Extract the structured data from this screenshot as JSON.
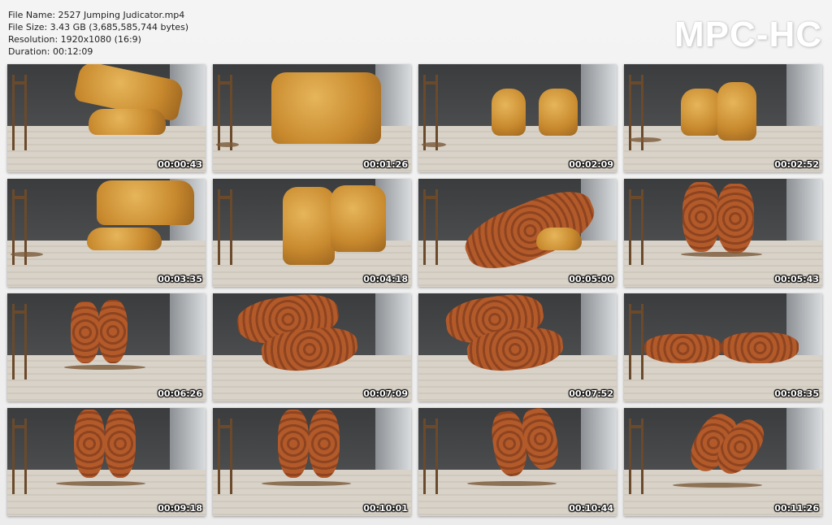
{
  "info": {
    "file_name": "File Name: 2527 Jumping Judicator.mp4",
    "file_size": "File Size: 3.43 GB (3,685,585,744 bytes)",
    "resolution": "Resolution: 1920x1080 (16:9)",
    "duration": "Duration: 00:12:09"
  },
  "logo": "MPC-HC",
  "thumbnails": [
    {
      "time": "00:00:43"
    },
    {
      "time": "00:01:26"
    },
    {
      "time": "00:02:09"
    },
    {
      "time": "00:02:52"
    },
    {
      "time": "00:03:35"
    },
    {
      "time": "00:04:18"
    },
    {
      "time": "00:05:00"
    },
    {
      "time": "00:05:43"
    },
    {
      "time": "00:06:26"
    },
    {
      "time": "00:07:09"
    },
    {
      "time": "00:07:52"
    },
    {
      "time": "00:08:35"
    },
    {
      "time": "00:09:18"
    },
    {
      "time": "00:10:01"
    },
    {
      "time": "00:10:44"
    },
    {
      "time": "00:11:26"
    }
  ]
}
